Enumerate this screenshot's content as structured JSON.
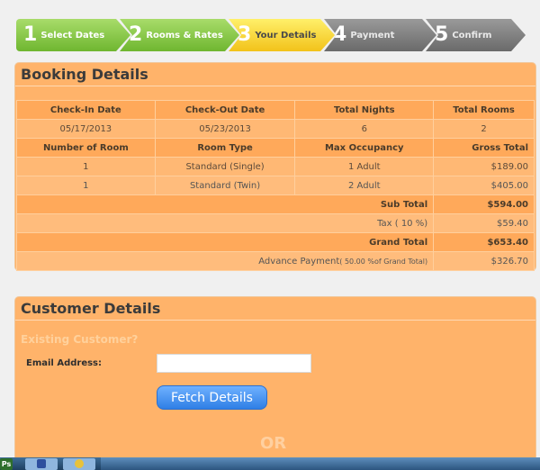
{
  "steps": [
    {
      "num": "1",
      "label": "Select Dates"
    },
    {
      "num": "2",
      "label": "Rooms & Rates"
    },
    {
      "num": "3",
      "label": "Your Details"
    },
    {
      "num": "4",
      "label": "Payment"
    },
    {
      "num": "5",
      "label": "Confirm"
    }
  ],
  "booking": {
    "title": "Booking Details",
    "headers1": [
      "Check-In Date",
      "Check-Out Date",
      "Total Nights",
      "Total Rooms"
    ],
    "values1": [
      "05/17/2013",
      "05/23/2013",
      "6",
      "2"
    ],
    "headers2": [
      "Number of Room",
      "Room Type",
      "Max Occupancy",
      "Gross Total"
    ],
    "rooms": [
      {
        "number": "1",
        "type": "Standard (Single)",
        "occupancy": "1 Adult",
        "gross": "$189.00"
      },
      {
        "number": "1",
        "type": "Standard (Twin)",
        "occupancy": "2 Adult",
        "gross": "$405.00"
      }
    ],
    "subtotal_label": "Sub Total",
    "subtotal_value": "$594.00",
    "tax_label": "Tax ( 10 %)",
    "tax_value": "$59.40",
    "grand_label": "Grand Total",
    "grand_value": "$653.40",
    "advance_label": "Advance Payment",
    "advance_note": "( 50.00 %of Grand Total)",
    "advance_value": "$326.70"
  },
  "customer": {
    "title": "Customer Details",
    "existing_label": "Existing Customer?",
    "email_label": "Email Address:",
    "email_value": "",
    "fetch_label": "Fetch Details",
    "or_label": "OR"
  },
  "taskbar": {
    "item1": "Ps"
  }
}
